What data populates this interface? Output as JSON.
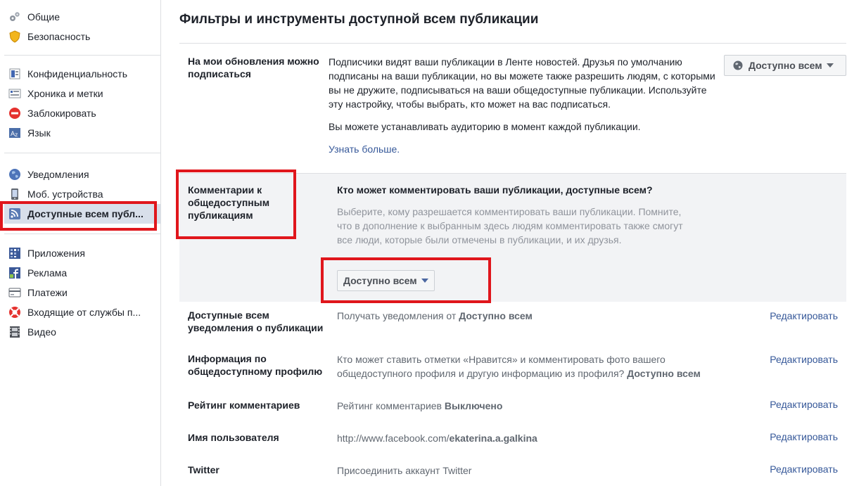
{
  "sidebar": {
    "groups": [
      [
        {
          "label": "Общие",
          "icon": "gears-icon"
        },
        {
          "label": "Безопасность",
          "icon": "shield-icon"
        }
      ],
      [
        {
          "label": "Конфиденциальность",
          "icon": "privacy-lock-icon"
        },
        {
          "label": "Хроника и метки",
          "icon": "timeline-icon"
        },
        {
          "label": "Заблокировать",
          "icon": "block-icon"
        },
        {
          "label": "Язык",
          "icon": "language-icon"
        }
      ],
      [
        {
          "label": "Уведомления",
          "icon": "globe-icon"
        },
        {
          "label": "Моб. устройства",
          "icon": "mobile-icon"
        },
        {
          "label": "Доступные всем публ...",
          "icon": "rss-icon",
          "active": true
        }
      ],
      [
        {
          "label": "Приложения",
          "icon": "apps-icon"
        },
        {
          "label": "Реклама",
          "icon": "ads-icon"
        },
        {
          "label": "Платежи",
          "icon": "payments-icon"
        },
        {
          "label": "Входящие от службы п...",
          "icon": "support-icon"
        },
        {
          "label": "Видео",
          "icon": "video-icon"
        }
      ]
    ]
  },
  "page": {
    "title": "Фильтры и инструменты доступной всем публикации"
  },
  "follow": {
    "label": "На мои обновления можно подписаться",
    "desc": "Подписчики видят ваши публикации в Ленте новостей. Друзья по умолчанию подписаны на ваши публикации, но вы можете также разрешить людям, с которыми вы не дружите, подписываться на ваши общедоступные публикации. Используйте эту настройку, чтобы выбрать, кто может на вас подписаться.",
    "desc2": "Вы можете устанавливать аудиторию в момент каждой публикации.",
    "learn_more": "Узнать больше.",
    "audience": "Доступно всем"
  },
  "comments": {
    "label": "Комментарии к общедоступным публикациям",
    "question": "Кто может комментировать ваши публикации, доступные всем?",
    "desc": "Выберите, кому разрешается комментировать ваши публикации. Помните, что в дополнение к выбранным здесь людям комментировать также смогут все люди, которые были отмечены в публикации, и их друзья.",
    "audience": "Доступно всем"
  },
  "rows": {
    "notifications": {
      "label": "Доступные всем уведомления о публикации",
      "desc_prefix": "Получать уведомления от ",
      "desc_value": "Доступно всем",
      "edit": "Редактировать"
    },
    "profile_info": {
      "label": "Информация по общедоступному профилю",
      "desc_prefix": "Кто может ставить отметки «Нравится» и комментировать фото вашего общедоступного профиля и другую информацию из профиля? ",
      "desc_value": "Доступно всем",
      "edit": "Редактировать"
    },
    "ranking": {
      "label": "Рейтинг комментариев",
      "desc_prefix": "Рейтинг комментариев ",
      "desc_value": "Выключено",
      "edit": "Редактировать"
    },
    "username": {
      "label": "Имя пользователя",
      "desc_prefix": "http://www.facebook.com/",
      "desc_value": "ekaterina.a.galkina",
      "edit": "Редактировать"
    },
    "twitter": {
      "label": "Twitter",
      "desc_prefix": "Присоединить аккаунт Twitter",
      "edit": "Редактировать"
    }
  },
  "colors": {
    "highlight": "#e0161c",
    "link": "#365899",
    "active_bg": "#d8dfea"
  }
}
